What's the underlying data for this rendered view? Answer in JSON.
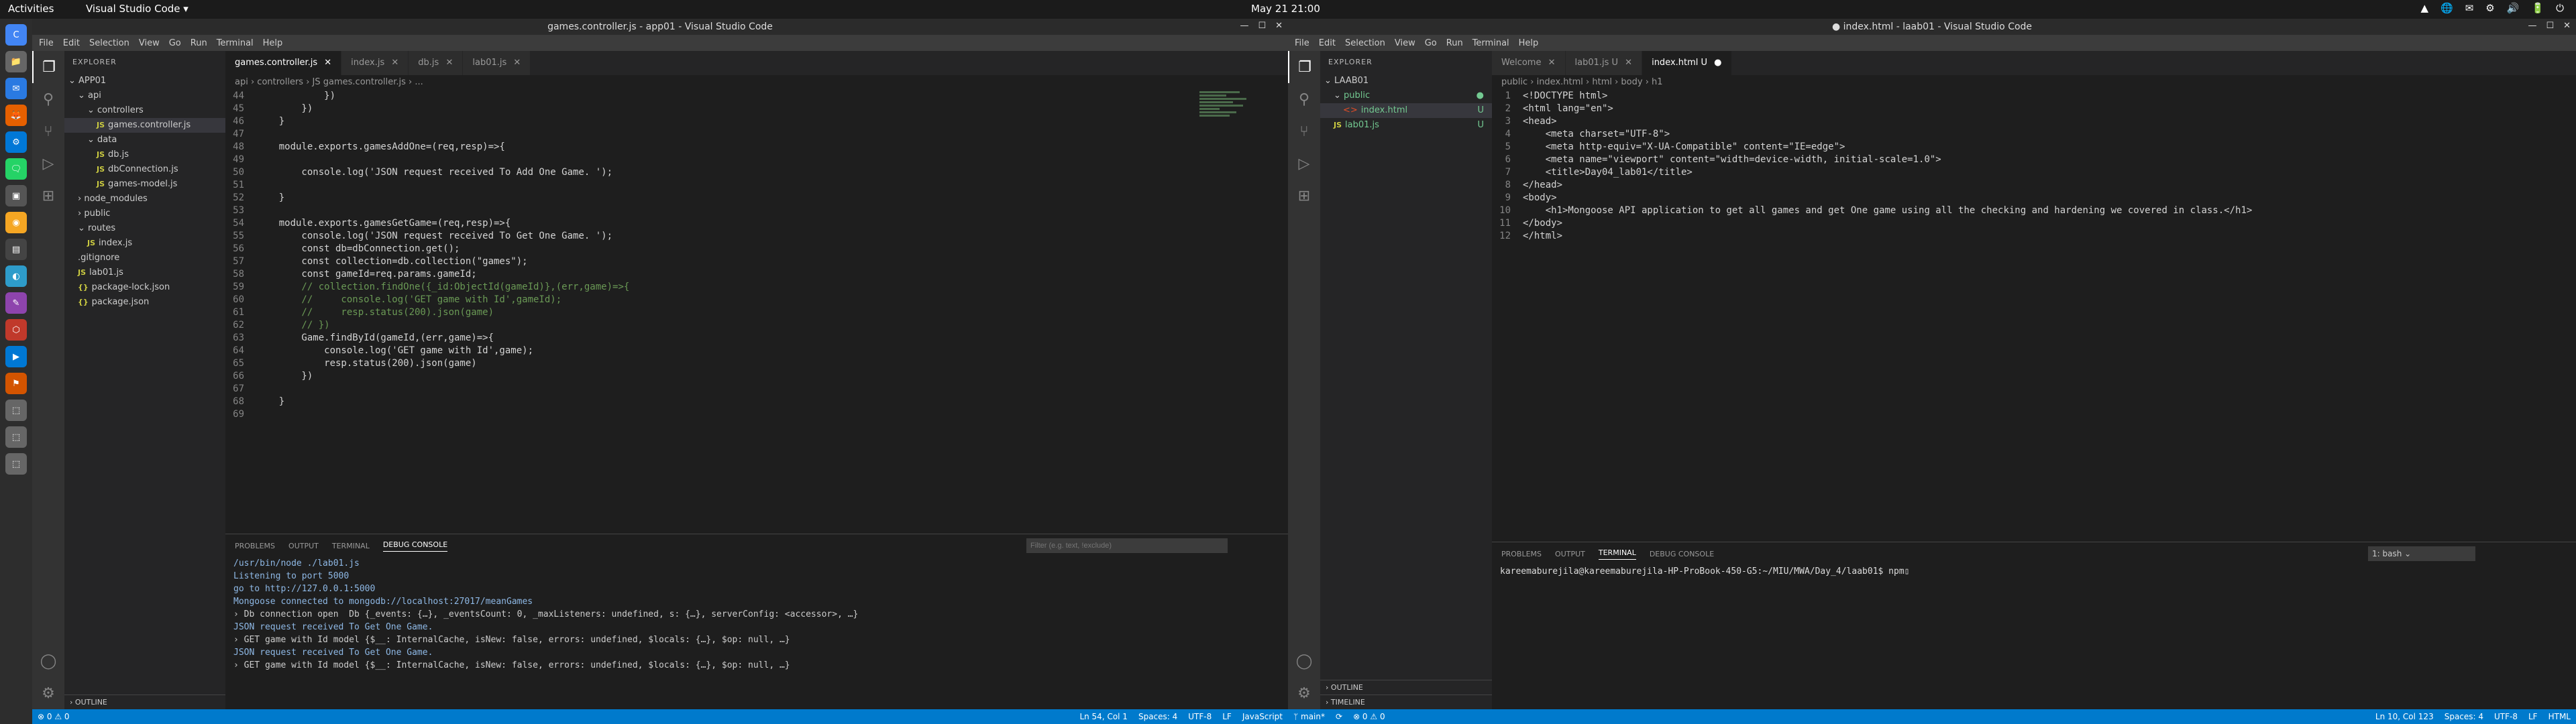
{
  "topbar": {
    "activities": "Activities",
    "app": "Visual Studio Code ▾",
    "clock": "May 21  21:00",
    "tray": [
      "▲",
      "🌐",
      "✉",
      "⚙",
      "🔊",
      "🔋",
      "⏻"
    ]
  },
  "dock": [
    "C",
    "📁",
    "✉",
    "🦊",
    "⚙",
    "🗨",
    "▣",
    "◉",
    "▤",
    "◐",
    "✎",
    "⬡",
    "▶",
    "⚑",
    "⬚",
    "⬚",
    "⬚"
  ],
  "left": {
    "title": "games.controller.js - app01 - Visual Studio Code",
    "menu": [
      "File",
      "Edit",
      "Selection",
      "View",
      "Go",
      "Run",
      "Terminal",
      "Help"
    ],
    "explorer_title": "EXPLORER",
    "tree": [
      {
        "label": "APP01",
        "indent": 0,
        "arrow": "⌄",
        "js": false
      },
      {
        "label": "api",
        "indent": 1,
        "arrow": "⌄",
        "js": false
      },
      {
        "label": "controllers",
        "indent": 2,
        "arrow": "⌄",
        "js": false
      },
      {
        "label": "games.controller.js",
        "indent": 3,
        "arrow": "",
        "js": true,
        "sel": true
      },
      {
        "label": "data",
        "indent": 2,
        "arrow": "⌄",
        "js": false
      },
      {
        "label": "db.js",
        "indent": 3,
        "arrow": "",
        "js": true
      },
      {
        "label": "dbConnection.js",
        "indent": 3,
        "arrow": "",
        "js": true
      },
      {
        "label": "games-model.js",
        "indent": 3,
        "arrow": "",
        "js": true
      },
      {
        "label": "node_modules",
        "indent": 1,
        "arrow": "›",
        "js": false
      },
      {
        "label": "public",
        "indent": 1,
        "arrow": "›",
        "js": false
      },
      {
        "label": "routes",
        "indent": 1,
        "arrow": "⌄",
        "js": false
      },
      {
        "label": "index.js",
        "indent": 2,
        "arrow": "",
        "js": true
      },
      {
        "label": ".gitignore",
        "indent": 1,
        "arrow": "",
        "js": false
      },
      {
        "label": "lab01.js",
        "indent": 1,
        "arrow": "",
        "js": true
      },
      {
        "label": "package-lock.json",
        "indent": 1,
        "arrow": "",
        "js": false,
        "json": true
      },
      {
        "label": "package.json",
        "indent": 1,
        "arrow": "",
        "js": false,
        "json": true
      }
    ],
    "outline": "OUTLINE",
    "tabs": [
      "games.controller.js",
      "index.js",
      "db.js",
      "lab01.js"
    ],
    "breadcrumb": "api › controllers › JS games.controller.js › ...",
    "code": [
      {
        "n": "44",
        "t": "            })"
      },
      {
        "n": "45",
        "t": "        })"
      },
      {
        "n": "46",
        "t": "    }"
      },
      {
        "n": "47",
        "t": ""
      },
      {
        "n": "48",
        "t": "    module.exports.gamesAddOne=(req,resp)=>{"
      },
      {
        "n": "49",
        "t": ""
      },
      {
        "n": "50",
        "t": "        console.log('JSON request received To Add One Game. ');"
      },
      {
        "n": "51",
        "t": ""
      },
      {
        "n": "52",
        "t": "    }"
      },
      {
        "n": "53",
        "t": ""
      },
      {
        "n": "54",
        "t": "    module.exports.gamesGetGame=(req,resp)=>{"
      },
      {
        "n": "55",
        "t": "        console.log('JSON request received To Get One Game. ');"
      },
      {
        "n": "56",
        "t": "        const db=dbConnection.get();"
      },
      {
        "n": "57",
        "t": "        const collection=db.collection(\"games\");"
      },
      {
        "n": "58",
        "t": "        const gameId=req.params.gameId;"
      },
      {
        "n": "59",
        "t": "        // collection.findOne({_id:ObjectId(gameId)},(err,game)=>{"
      },
      {
        "n": "60",
        "t": "        //     console.log('GET game with Id',gameId);"
      },
      {
        "n": "61",
        "t": "        //     resp.status(200).json(game)"
      },
      {
        "n": "62",
        "t": "        // })"
      },
      {
        "n": "63",
        "t": "        Game.findById(gameId,(err,game)=>{"
      },
      {
        "n": "64",
        "t": "            console.log('GET game with Id',game);"
      },
      {
        "n": "65",
        "t": "            resp.status(200).json(game)"
      },
      {
        "n": "66",
        "t": "        })"
      },
      {
        "n": "67",
        "t": ""
      },
      {
        "n": "68",
        "t": "    }"
      },
      {
        "n": "69",
        "t": ""
      }
    ],
    "panel_tabs": [
      "PROBLEMS",
      "OUTPUT",
      "TERMINAL",
      "DEBUG CONSOLE"
    ],
    "filter_placeholder": "Filter (e.g. text, !exclude)",
    "console": [
      "/usr/bin/node ./lab01.js",
      "Listening to port 5000",
      "go to http://127.0.0.1:5000",
      "Mongoose connected to mongodb://localhost:27017/meanGames",
      "› Db connection open  Db {_events: {…}, _eventsCount: 0, _maxListeners: undefined, s: {…}, serverConfig: <accessor>, …}",
      "JSON request received To Get One Game.",
      "› GET game with Id model {$__: InternalCache, isNew: false, errors: undefined, $locals: {…}, $op: null, …}",
      "JSON request received To Get One Game.",
      "› GET game with Id model {$__: InternalCache, isNew: false, errors: undefined, $locals: {…}, $op: null, …}"
    ],
    "status": {
      "left": "⊗ 0 ⚠ 0",
      "pos": "Ln 54, Col 1",
      "spaces": "Spaces: 4",
      "enc": "UTF-8",
      "eol": "LF",
      "lang": "JavaScript"
    }
  },
  "right": {
    "title": "● index.html - laab01 - Visual Studio Code",
    "menu": [
      "File",
      "Edit",
      "Selection",
      "View",
      "Go",
      "Run",
      "Terminal",
      "Help"
    ],
    "explorer_title": "EXPLORER",
    "tree": [
      {
        "label": "LAAB01",
        "indent": 0,
        "arrow": "⌄"
      },
      {
        "label": "public",
        "indent": 1,
        "arrow": "⌄",
        "badge": "●"
      },
      {
        "label": "index.html",
        "indent": 2,
        "arrow": "",
        "sel": true,
        "badge": "U",
        "html": true
      },
      {
        "label": "lab01.js",
        "indent": 1,
        "arrow": "",
        "badge": "U",
        "js": true
      }
    ],
    "outline": "OUTLINE",
    "timeline": "TIMELINE",
    "tabs": [
      "Welcome",
      "lab01.js U",
      "index.html U"
    ],
    "breadcrumb": "public › index.html › html › body › h1",
    "code": [
      {
        "n": "1",
        "t": "<!DOCTYPE html>"
      },
      {
        "n": "2",
        "t": "<html lang=\"en\">"
      },
      {
        "n": "3",
        "t": "<head>"
      },
      {
        "n": "4",
        "t": "    <meta charset=\"UTF-8\">"
      },
      {
        "n": "5",
        "t": "    <meta http-equiv=\"X-UA-Compatible\" content=\"IE=edge\">"
      },
      {
        "n": "6",
        "t": "    <meta name=\"viewport\" content=\"width=device-width, initial-scale=1.0\">"
      },
      {
        "n": "7",
        "t": "    <title>Day04_lab01</title>"
      },
      {
        "n": "8",
        "t": "</head>"
      },
      {
        "n": "9",
        "t": "<body>"
      },
      {
        "n": "10",
        "t": "    <h1>Mongoose API application to get all games and get One game using all the checking and hardening we covered in class.</h1>"
      },
      {
        "n": "11",
        "t": "</body>"
      },
      {
        "n": "12",
        "t": "</html>"
      }
    ],
    "panel_tabs": [
      "PROBLEMS",
      "OUTPUT",
      "TERMINAL",
      "DEBUG CONSOLE"
    ],
    "terminal_select": "1: bash",
    "terminal": "kareemaburejila@kareemaburejila-HP-ProBook-450-G5:~/MIU/MWA/Day_4/laab01$ npm▯",
    "status": {
      "branch": "ᛘ main*",
      "sync": "⟳",
      "errs": "⊗ 0 ⚠ 0",
      "pos": "Ln 10, Col 123",
      "spaces": "Spaces: 4",
      "enc": "UTF-8",
      "eol": "LF",
      "lang": "HTML"
    }
  }
}
